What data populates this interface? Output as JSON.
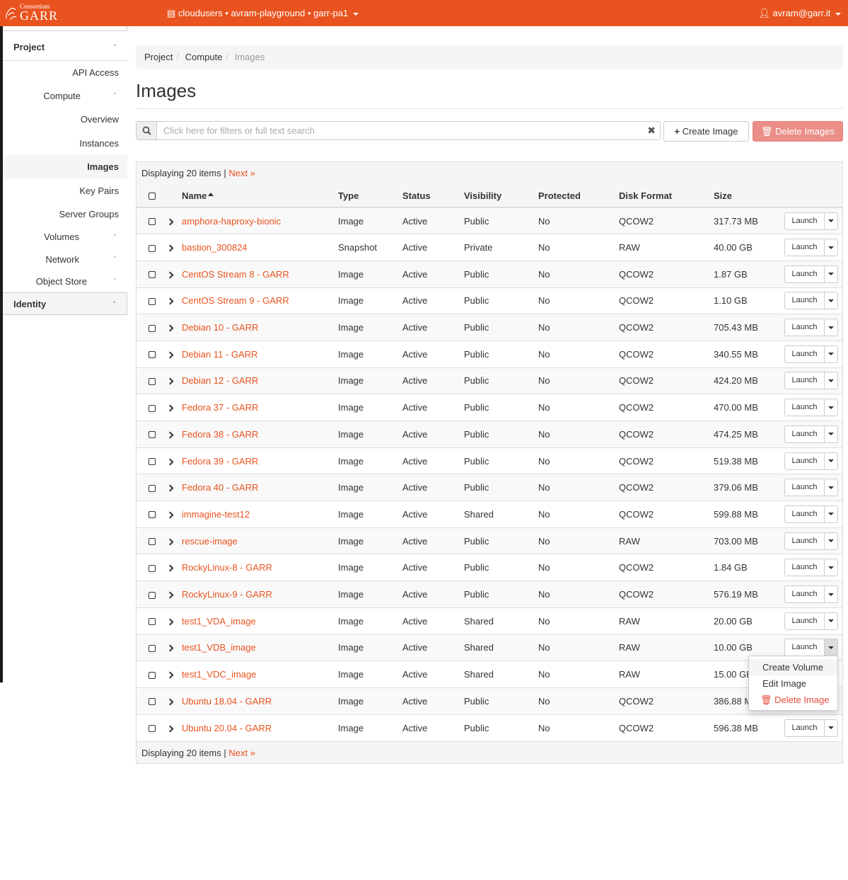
{
  "brand": {
    "line1": "Consortium",
    "line2": "GARR"
  },
  "header": {
    "project_context": "cloudusers • avram-playground • garr-pa1",
    "user": "avram@garr.it"
  },
  "sidebar": {
    "project_label": "Project",
    "api_access": "API Access",
    "compute_label": "Compute",
    "compute_items": [
      "Overview",
      "Instances",
      "Images",
      "Key Pairs",
      "Server Groups"
    ],
    "volumes": "Volumes",
    "network": "Network",
    "object_store": "Object Store",
    "identity": "Identity"
  },
  "breadcrumb": [
    "Project",
    "Compute",
    "Images"
  ],
  "page_title": "Images",
  "search": {
    "placeholder": "Click here for filters or full text search"
  },
  "buttons": {
    "create": "Create Image",
    "delete": "Delete Images",
    "launch": "Launch"
  },
  "table": {
    "displaying": "Displaying 20 items |",
    "next": "Next »",
    "columns": [
      "Name",
      "Type",
      "Status",
      "Visibility",
      "Protected",
      "Disk Format",
      "Size"
    ],
    "rows": [
      {
        "name": "amphora-haproxy-bionic",
        "type": "Image",
        "status": "Active",
        "visibility": "Public",
        "protected": "No",
        "format": "QCOW2",
        "size": "317.73 MB"
      },
      {
        "name": "bastion_300824",
        "type": "Snapshot",
        "status": "Active",
        "visibility": "Private",
        "protected": "No",
        "format": "RAW",
        "size": "40.00 GB"
      },
      {
        "name": "CentOS Stream 8 - GARR",
        "type": "Image",
        "status": "Active",
        "visibility": "Public",
        "protected": "No",
        "format": "QCOW2",
        "size": "1.87 GB"
      },
      {
        "name": "CentOS Stream 9 - GARR",
        "type": "Image",
        "status": "Active",
        "visibility": "Public",
        "protected": "No",
        "format": "QCOW2",
        "size": "1.10 GB"
      },
      {
        "name": "Debian 10 - GARR",
        "type": "Image",
        "status": "Active",
        "visibility": "Public",
        "protected": "No",
        "format": "QCOW2",
        "size": "705.43 MB"
      },
      {
        "name": "Debian 11 - GARR",
        "type": "Image",
        "status": "Active",
        "visibility": "Public",
        "protected": "No",
        "format": "QCOW2",
        "size": "340.55 MB"
      },
      {
        "name": "Debian 12 - GARR",
        "type": "Image",
        "status": "Active",
        "visibility": "Public",
        "protected": "No",
        "format": "QCOW2",
        "size": "424.20 MB"
      },
      {
        "name": "Fedora 37 - GARR",
        "type": "Image",
        "status": "Active",
        "visibility": "Public",
        "protected": "No",
        "format": "QCOW2",
        "size": "470.00 MB"
      },
      {
        "name": "Fedora 38 - GARR",
        "type": "Image",
        "status": "Active",
        "visibility": "Public",
        "protected": "No",
        "format": "QCOW2",
        "size": "474.25 MB"
      },
      {
        "name": "Fedora 39 - GARR",
        "type": "Image",
        "status": "Active",
        "visibility": "Public",
        "protected": "No",
        "format": "QCOW2",
        "size": "519.38 MB"
      },
      {
        "name": "Fedora 40 - GARR",
        "type": "Image",
        "status": "Active",
        "visibility": "Public",
        "protected": "No",
        "format": "QCOW2",
        "size": "379.06 MB"
      },
      {
        "name": "immagine-test12",
        "type": "Image",
        "status": "Active",
        "visibility": "Shared",
        "protected": "No",
        "format": "QCOW2",
        "size": "599.88 MB"
      },
      {
        "name": "rescue-image",
        "type": "Image",
        "status": "Active",
        "visibility": "Public",
        "protected": "No",
        "format": "RAW",
        "size": "703.00 MB"
      },
      {
        "name": "RockyLinux-8 - GARR",
        "type": "Image",
        "status": "Active",
        "visibility": "Public",
        "protected": "No",
        "format": "QCOW2",
        "size": "1.84 GB"
      },
      {
        "name": "RockyLinux-9 - GARR",
        "type": "Image",
        "status": "Active",
        "visibility": "Public",
        "protected": "No",
        "format": "QCOW2",
        "size": "576.19 MB"
      },
      {
        "name": "test1_VDA_image",
        "type": "Image",
        "status": "Active",
        "visibility": "Shared",
        "protected": "No",
        "format": "RAW",
        "size": "20.00 GB"
      },
      {
        "name": "test1_VDB_image",
        "type": "Image",
        "status": "Active",
        "visibility": "Shared",
        "protected": "No",
        "format": "RAW",
        "size": "10.00 GB"
      },
      {
        "name": "test1_VDC_image",
        "type": "Image",
        "status": "Active",
        "visibility": "Shared",
        "protected": "No",
        "format": "RAW",
        "size": "15.00 GB"
      },
      {
        "name": "Ubuntu 18.04 - GARR",
        "type": "Image",
        "status": "Active",
        "visibility": "Public",
        "protected": "No",
        "format": "QCOW2",
        "size": "386.88 MB"
      },
      {
        "name": "Ubuntu 20.04 - GARR",
        "type": "Image",
        "status": "Active",
        "visibility": "Public",
        "protected": "No",
        "format": "QCOW2",
        "size": "596.38 MB"
      }
    ]
  },
  "dropdown": {
    "items": [
      "Create Volume",
      "Edit Image",
      "Delete Image"
    ]
  },
  "colors": {
    "accent": "#e9531f",
    "danger": "#eb8e87"
  }
}
